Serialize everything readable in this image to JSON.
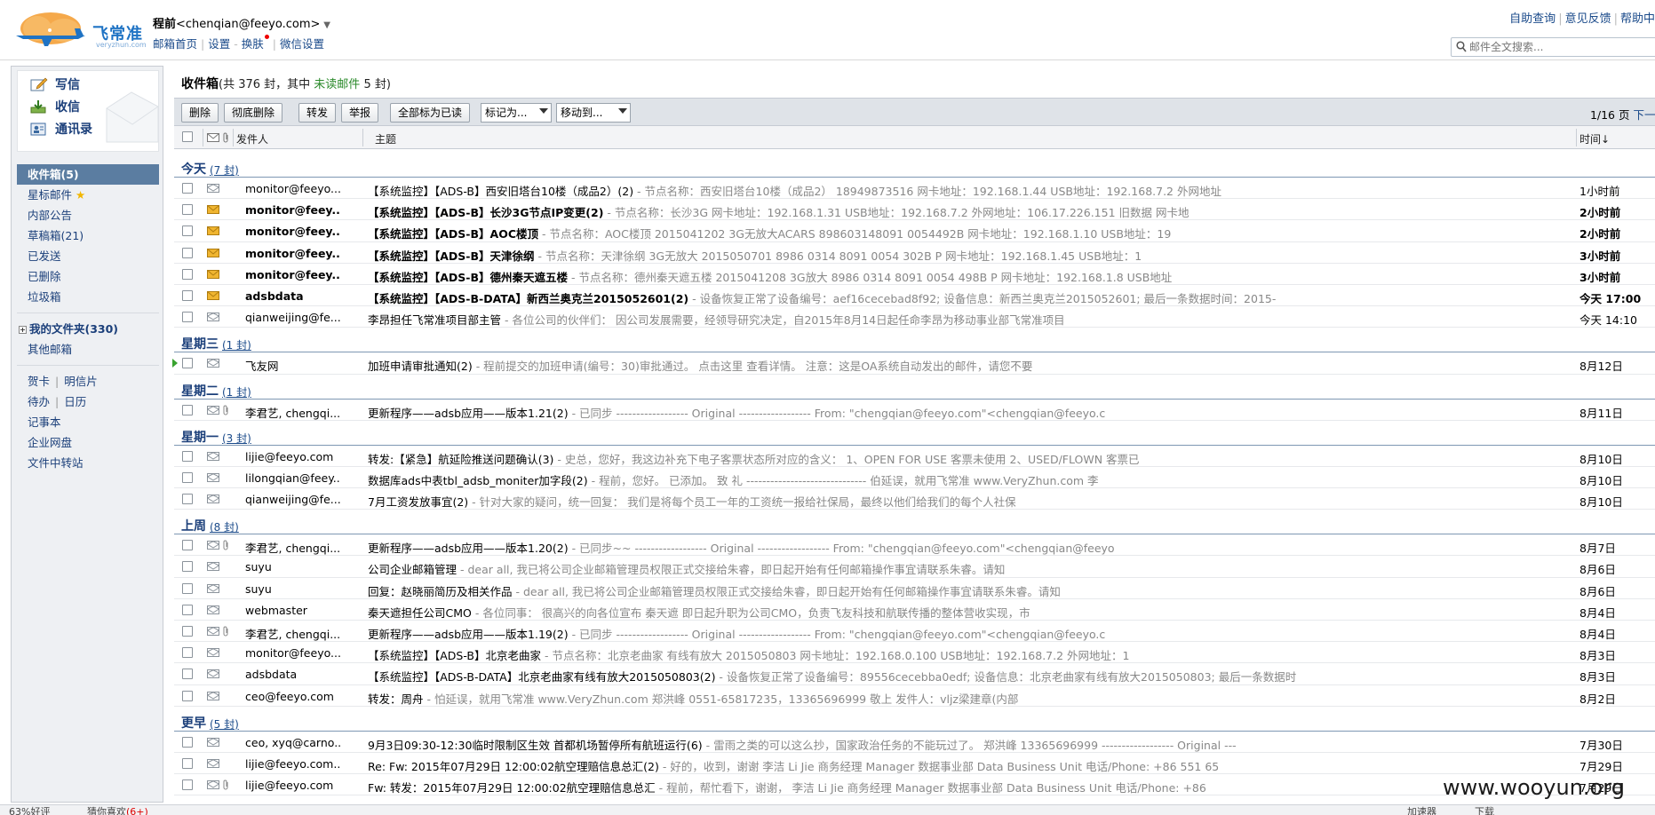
{
  "header": {
    "logo_text": "飞常准",
    "logo_sub": "veryzhun.com",
    "user_name": "程前",
    "user_email": "<chenqian@feeyo.com>",
    "user_caret": "▼",
    "links": {
      "home": "邮箱首页",
      "settings": "设置",
      "skin": "换肤",
      "wechat": "微信设置"
    },
    "help": {
      "self_query": "自助查询",
      "feedback": "意见反馈",
      "help_center": "帮助中"
    },
    "search_placeholder": "邮件全文搜索..."
  },
  "sidebar": {
    "compose": "写信",
    "receive": "收信",
    "contacts": "通讯录",
    "folders": {
      "inbox": "收件箱(5)",
      "starred": "星标邮件",
      "announcements": "内部公告",
      "drafts": "草稿箱(21)",
      "sent": "已发送",
      "deleted": "已删除",
      "spam": "垃圾箱",
      "tree_toggle": "+",
      "my_folders": "我的文件夹(330)",
      "other_mailboxes": "其他邮箱"
    },
    "tools": {
      "greeting_card": "贺卡",
      "postcard": "明信片",
      "todo": "待办",
      "calendar": "日历",
      "notes": "记事本",
      "netdisk": "企业网盘",
      "transfer": "文件中转站"
    }
  },
  "main": {
    "title": "收件箱",
    "summary_prefix": "(共 376 封，其中 ",
    "summary_unread": "未读邮件",
    "summary_suffix": " 5 封)",
    "toolbar": {
      "delete": "删除",
      "delete_perm": "彻底删除",
      "forward": "转发",
      "report": "举报",
      "mark_all_read": "全部标为已读",
      "mark_as": "标记为...",
      "move_to": "移动到..."
    },
    "pager": {
      "page": "1/16 页",
      "next": "下一页"
    },
    "columns": {
      "sender": "发件人",
      "subject": "主题",
      "time": "时间↓"
    }
  },
  "groups": [
    {
      "label": "今天",
      "count": "(7 封)",
      "rows": [
        {
          "from": "monitor@feeyo....",
          "subject": "【系统监控】【ADS-B】西安旧塔台10楼（成品2）(2)",
          "preview": " - 节点名称：西安旧塔台10楼（成品2） 18949873516 网卡地址：192.168.1.44 USB地址：192.168.7.2 外网地址",
          "time": "1小时前",
          "unread": false,
          "envelope": "read",
          "clip": false
        },
        {
          "from": "monitor@feey...",
          "subject": "【系统监控】【ADS-B】长沙3G节点IP变更(2)",
          "preview": " - 节点名称：长沙3G 网卡地址：192.168.1.31 USB地址：192.168.7.2 外网地址：106.17.226.151 旧数据 网卡地",
          "time": "2小时前",
          "unread": true,
          "envelope": "unread",
          "clip": false
        },
        {
          "from": "monitor@feey...",
          "subject": "【系统监控】【ADS-B】AOC楼顶",
          "preview": " - 节点名称：AOC楼顶 2015041202 3G无放大ACARS 898603148091 0054492B 网卡地址：192.168.1.10 USB地址：19",
          "time": "2小时前",
          "unread": true,
          "envelope": "unread",
          "clip": false
        },
        {
          "from": "monitor@feey...",
          "subject": "【系统监控】【ADS-B】天津徐纲",
          "preview": " - 节点名称：天津徐纲 3G无放大 2015050701 8986 0314 8091 0054 302B P 网卡地址：192.168.1.45 USB地址：1",
          "time": "3小时前",
          "unread": true,
          "envelope": "unread",
          "clip": false
        },
        {
          "from": "monitor@feey...",
          "subject": "【系统监控】【ADS-B】德州秦天遮五楼",
          "preview": " - 节点名称：德州秦天遮五楼 2015041208 3G放大 8986 0314 8091 0054 498B P 网卡地址：192.168.1.8 USB地址",
          "time": "3小时前",
          "unread": true,
          "envelope": "unread",
          "clip": false
        },
        {
          "from": "adsbdata",
          "subject": "【系统监控】【ADS-B-DATA】新西兰奥克兰2015052601(2)",
          "preview": " - 设备恢复正常了设备编号：aef16cecebad8f92; 设备信息：新西兰奥克兰2015052601; 最后一条数据时间：2015-",
          "time": "今天 17:00",
          "unread": true,
          "envelope": "unread",
          "clip": false
        },
        {
          "from": "qianweijing@fe...",
          "subject": "李昂担任飞常准项目部主管",
          "preview": " - 各位公司的伙伴们： 因公司发展需要，经领导研究决定，自2015年8月14日起任命李昂为移动事业部飞常准项目",
          "time": "今天 14:10",
          "unread": false,
          "envelope": "read",
          "clip": false
        }
      ]
    },
    {
      "label": "星期三",
      "count": "(1 封)",
      "rows": [
        {
          "from": "飞友网",
          "subject": "加班申请审批通知(2)",
          "preview": " - 程前提交的加班申请(编号：30)审批通过。 点击这里 查看详情。 注意：这是OA系统自动发出的邮件，请您不要",
          "time": "8月12日",
          "unread": false,
          "envelope": "read",
          "clip": false,
          "flag": true
        }
      ]
    },
    {
      "label": "星期二",
      "count": "(1 封)",
      "rows": [
        {
          "from": "李君艺, chengqi...",
          "subject": "更新程序——adsb应用——版本1.21(2)",
          "preview": " - 已同步 ------------------ Original ------------------ From: \"chengqian@feeyo.com\"<chengqian@feeyo.c",
          "time": "8月11日",
          "unread": false,
          "envelope": "read",
          "clip": true
        }
      ]
    },
    {
      "label": "星期一",
      "count": "(3 封)",
      "rows": [
        {
          "from": "lijie@feeyo.com",
          "subject": "转发:【紧急】航延险推送问题确认(3)",
          "preview": " - 史总，您好，我这边补充下电子客票状态所对应的含义： 1、OPEN FOR USE 客票未使用 2、USED/FLOWN 客票已",
          "time": "8月10日",
          "unread": false,
          "envelope": "read",
          "clip": false
        },
        {
          "from": "lilongqian@feey...",
          "subject": "数据库ads中表tbl_adsb_moniter加字段(2)",
          "preview": " - 程前，您好。 已添加。 致 礼 ------------------------------ 伯延误，就用飞常准 www.VeryZhun.com 李",
          "time": "8月10日",
          "unread": false,
          "envelope": "read",
          "clip": false
        },
        {
          "from": "qianweijing@fe...",
          "subject": "7月工资发放事宜(2)",
          "preview": " - 针对大家的疑问，统一回复： 我们是将每个员工一年的工资统一报给社保局，最终以他们给我们的每个人社保",
          "time": "8月10日",
          "unread": false,
          "envelope": "read",
          "clip": false
        }
      ]
    },
    {
      "label": "上周",
      "count": "(8 封)",
      "rows": [
        {
          "from": "李君艺, chengqi...",
          "subject": "更新程序——adsb应用——版本1.20(2)",
          "preview": " - 已同步~~ ------------------ Original ------------------ From: \"chengqian@feeyo.com\"<chengqian@feeyo",
          "time": "8月7日",
          "unread": false,
          "envelope": "read",
          "clip": true
        },
        {
          "from": "suyu",
          "subject": "公司企业邮箱管理",
          "preview": " - dear all, 我已将公司企业邮箱管理员权限正式交接给朱睿，即日起开始有任何邮箱操作事宜请联系朱睿。请知",
          "time": "8月6日",
          "unread": false,
          "envelope": "read",
          "clip": false
        },
        {
          "from": "suyu",
          "subject": "回复：赵晓丽简历及相关作品",
          "preview": " - dear all, 我已将公司企业邮箱管理员权限正式交接给朱睿，即日起开始有任何邮箱操作事宜请联系朱睿。请知",
          "time": "8月6日",
          "unread": false,
          "envelope": "read",
          "clip": false
        },
        {
          "from": "webmaster",
          "subject": "秦天遮担任公司CMO",
          "preview": " - 各位同事： 很高兴的向各位宣布 秦天遮 即日起升职为公司CMO，负责飞友科技和航联传播的整体营收实现，市",
          "time": "8月4日",
          "unread": false,
          "envelope": "read",
          "clip": false
        },
        {
          "from": "李君艺, chengqi...",
          "subject": "更新程序——adsb应用——版本1.19(2)",
          "preview": " - 已同步 ------------------ Original ------------------ From: \"chengqian@feeyo.com\"<chengqian@feeyo.c",
          "time": "8月4日",
          "unread": false,
          "envelope": "read",
          "clip": true
        },
        {
          "from": "monitor@feeyo....",
          "subject": "【系统监控】【ADS-B】北京老曲家",
          "preview": " - 节点名称：北京老曲家 有线有放大 2015050803 网卡地址：192.168.0.100 USB地址：192.168.7.2 外网地址：1",
          "time": "8月3日",
          "unread": false,
          "envelope": "read",
          "clip": false
        },
        {
          "from": "adsbdata",
          "subject": "【系统监控】【ADS-B-DATA】北京老曲家有线有放大2015050803(2)",
          "preview": " - 设备恢复正常了设备编号：89556cecebba0edf; 设备信息：北京老曲家有线有放大2015050803; 最后一条数据时",
          "time": "8月3日",
          "unread": false,
          "envelope": "read",
          "clip": false
        },
        {
          "from": "ceo@feeyo.com",
          "subject": "转发：周舟",
          "preview": " - 怕延误，就用飞常准 www.VeryZhun.com 郑洪峰 0551-65817235，13365696999 敬上 发件人：vljz梁建章(内部",
          "time": "8月2日",
          "unread": false,
          "envelope": "read",
          "clip": false
        }
      ]
    },
    {
      "label": "更早",
      "count": "(5 封)",
      "rows": [
        {
          "from": "ceo, xyq@carno...",
          "subject": "9月3日09:30-12:30临时限制区生效 首都机场暂停所有航班运行(6)",
          "preview": " - 雷雨之类的可以这么抄，国家政治任务的不能玩过了。 郑洪峰 13365696999 ------------------ Original ---",
          "time": "7月30日",
          "unread": false,
          "envelope": "read",
          "clip": false
        },
        {
          "from": "lijie@feeyo.com...",
          "subject": "Re: Fw: 2015年07月29日 12:00:02航空理赔信息总汇(2)",
          "preview": " - 好的，收到，谢谢 李洁 Li Jie 商务经理 Manager 数据事业部 Data Business Unit 电话/Phone: +86 551 65",
          "time": "7月29日",
          "unread": false,
          "envelope": "read",
          "clip": false
        },
        {
          "from": "lijie@feeyo.com",
          "subject": "Fw: 转发：2015年07月29日 12:00:02航空理赔信息总汇",
          "preview": " - 程前，帮忙看下，谢谢， 李洁 Li Jie 商务经理 Manager 数据事业部 Data Business Unit 电话/Phone: +86",
          "time": "7月29日",
          "unread": false,
          "envelope": "read",
          "clip": true
        }
      ]
    }
  ],
  "statusbar": {
    "rating": "63%好评",
    "guess": "猜你喜欢",
    "guess_count": "(6+)",
    "accelerator": "加速器",
    "download": "下载"
  },
  "watermark": "www.wooyun.org",
  "colors": {
    "accent": "#1b3f7a",
    "active_folder": "#5b7da1",
    "unread_count": "#2b8a2b",
    "flag": "#39a32f",
    "envelope_unread": "#f0b530"
  }
}
